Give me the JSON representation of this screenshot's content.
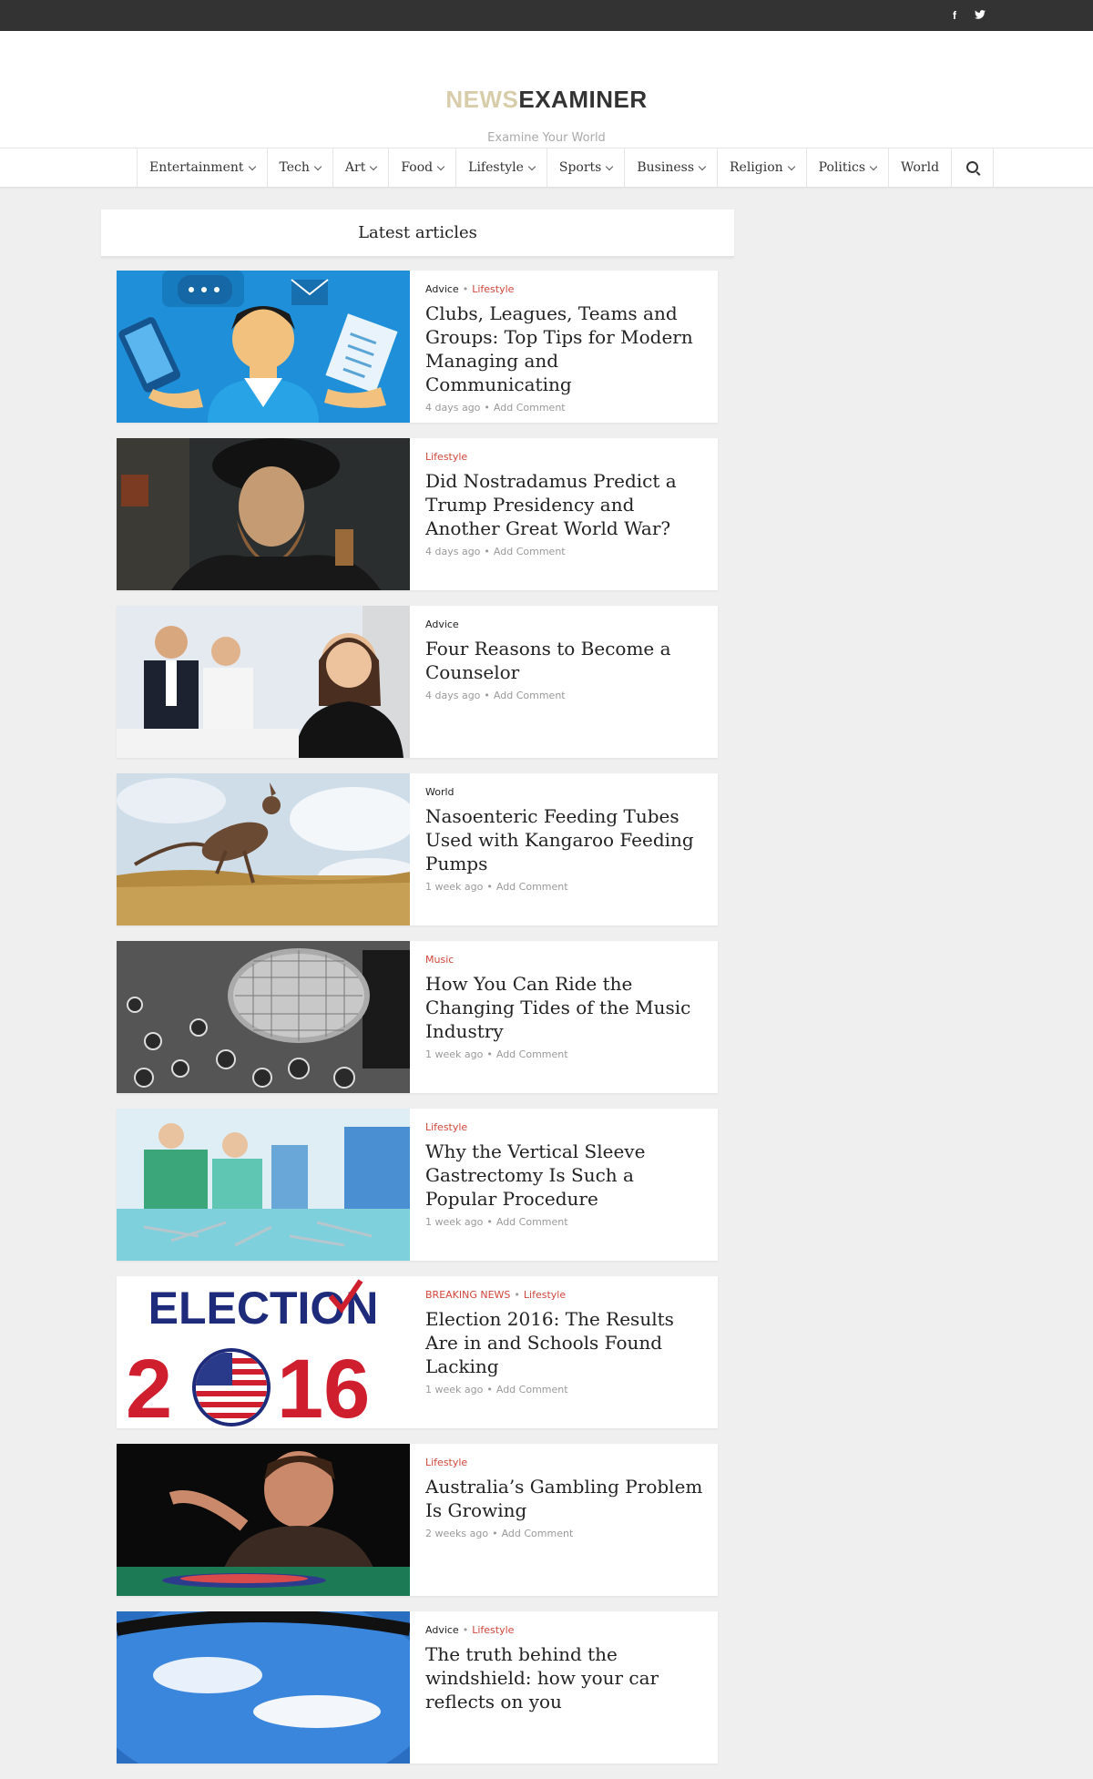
{
  "topbar": {
    "social": [
      "f",
      "t"
    ]
  },
  "site": {
    "logo_part1": "NEWS",
    "logo_part2": "EXAMINER",
    "tagline": "Examine Your World"
  },
  "nav": {
    "items": [
      {
        "label": "Entertainment",
        "dropdown": true
      },
      {
        "label": "Tech",
        "dropdown": true
      },
      {
        "label": "Art",
        "dropdown": true
      },
      {
        "label": "Food",
        "dropdown": true
      },
      {
        "label": "Lifestyle",
        "dropdown": true
      },
      {
        "label": "Sports",
        "dropdown": true
      },
      {
        "label": "Business",
        "dropdown": true
      },
      {
        "label": "Religion",
        "dropdown": true
      },
      {
        "label": "Politics",
        "dropdown": true
      },
      {
        "label": "World",
        "dropdown": false
      }
    ],
    "search_icon": "search-icon"
  },
  "section": {
    "title": "Latest articles"
  },
  "articles": [
    {
      "cats": [
        "Advice",
        "Lifestyle"
      ],
      "title": "Clubs, Leagues, Teams and Groups: Top Tips for Modern Managing and Communicating",
      "age": "4 days ago",
      "comment": "Add Comment",
      "thumb": "manager-with-phone-illustration"
    },
    {
      "cats": [
        "Lifestyle"
      ],
      "title": "Did Nostradamus Predict a Trump Presidency and Another Great World War?",
      "age": "4 days ago",
      "comment": "Add Comment",
      "thumb": "nostradamus-portrait"
    },
    {
      "cats": [
        "Advice"
      ],
      "title": "Four Reasons to Become a Counselor",
      "age": "4 days ago",
      "comment": "Add Comment",
      "thumb": "business-people-meeting"
    },
    {
      "cats": [
        "World"
      ],
      "title": "Nasoenteric Feeding Tubes Used with Kangaroo Feeding Pumps",
      "age": "1 week ago",
      "comment": "Add Comment",
      "thumb": "kangaroo-jumping"
    },
    {
      "cats": [
        "Music"
      ],
      "title": "How You Can Ride the Changing Tides of the Music Industry",
      "age": "1 week ago",
      "comment": "Add Comment",
      "thumb": "microphone-mixer"
    },
    {
      "cats": [
        "Lifestyle"
      ],
      "title": "Why the Vertical Sleeve Gastrectomy Is Such a Popular Procedure",
      "age": "1 week ago",
      "comment": "Add Comment",
      "thumb": "surgery-room"
    },
    {
      "cats": [
        "BREAKING NEWS",
        "Lifestyle"
      ],
      "title": "Election 2016: The Results Are in and Schools Found Lacking",
      "age": "1 week ago",
      "comment": "Add Comment",
      "thumb": "election-2016-logo",
      "thumb_text1": "ELECTION",
      "thumb_text2": "2016"
    },
    {
      "cats": [
        "Lifestyle"
      ],
      "title": "Australia’s Gambling Problem Is Growing",
      "age": "2 weeks ago",
      "comment": "Add Comment",
      "thumb": "gambling-man-chips"
    },
    {
      "cats": [
        "Advice",
        "Lifestyle"
      ],
      "title": "The truth behind the windshield: how your car reflects on you",
      "age": "",
      "comment": "",
      "thumb": "car-windshield-sky"
    }
  ],
  "colors": {
    "accent": "#d0463b",
    "topbar": "#333333",
    "logo_light": "#d8cdab",
    "background": "#efefef"
  }
}
